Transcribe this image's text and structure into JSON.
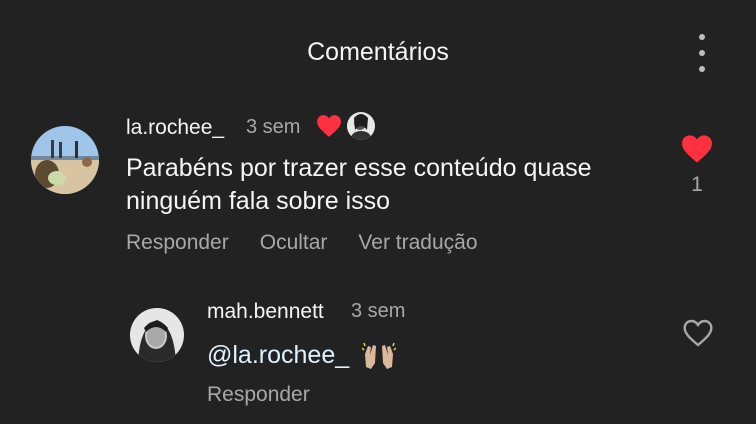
{
  "header": {
    "title": "Comentários"
  },
  "comments": [
    {
      "username": "la.rochee_",
      "time": "3 sem",
      "text_line1": "Parabéns por trazer esse conteúdo quase",
      "text_line2": "ninguém fala sobre isso",
      "actions": [
        "Responder",
        "Ocultar",
        "Ver tradução"
      ],
      "like_count": "1",
      "liked_by_author": true,
      "liked": true
    },
    {
      "username": "mah.bennett",
      "time": "3 sem",
      "mention": "@la.rochee_",
      "emoji": "raising-hands-emoji",
      "actions": [
        "Responder"
      ],
      "liked": false
    }
  ],
  "colors": {
    "background": "#222222",
    "text": "#f5f5f5",
    "muted": "#a8a8a8",
    "like_red": "#ff3040",
    "mention": "#e0f1ff"
  }
}
